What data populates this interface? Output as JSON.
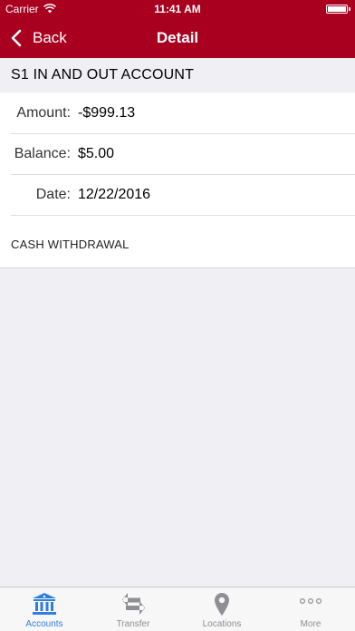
{
  "status_bar": {
    "carrier": "Carrier",
    "time": "11:41 AM",
    "battery_level": 1.0
  },
  "nav": {
    "back_label": "Back",
    "title": "Detail"
  },
  "account": {
    "name": "S1 IN AND OUT ACCOUNT"
  },
  "details": {
    "amount_label": "Amount:",
    "amount_value": "-$999.13",
    "balance_label": "Balance:",
    "balance_value": "$5.00",
    "date_label": "Date:",
    "date_value": "12/22/2016",
    "memo": "CASH WITHDRAWAL"
  },
  "tabs": [
    {
      "label": "Accounts",
      "icon": "bank-icon",
      "active": true
    },
    {
      "label": "Transfer",
      "icon": "transfer-arrows-icon",
      "active": false
    },
    {
      "label": "Locations",
      "icon": "map-pin-icon",
      "active": false
    },
    {
      "label": "More",
      "icon": "more-dots-icon",
      "active": false
    }
  ],
  "colors": {
    "brand": "#a8001e",
    "tab_active": "#2f7ee0",
    "tab_inactive": "#8e8e93",
    "background": "#efeff4"
  }
}
